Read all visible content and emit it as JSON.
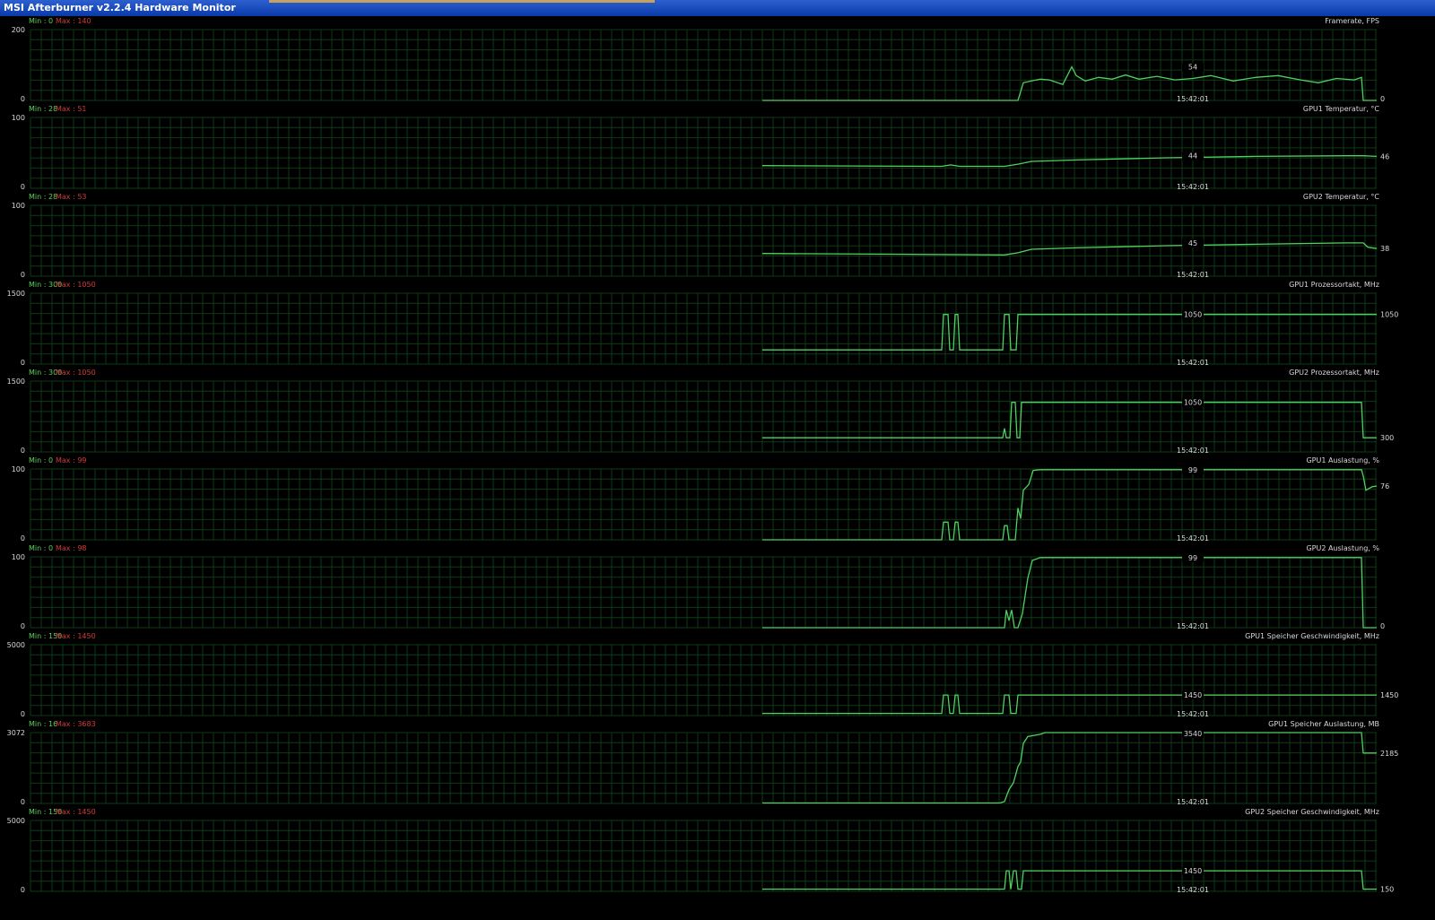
{
  "window": {
    "title": "MSI Afterburner v2.2.4 Hardware Monitor"
  },
  "colors": {
    "grid": "#0e3a16",
    "line": "#50d060",
    "text": "#d8d8d8",
    "min": "#5fcf5f",
    "max": "#cf3a3a"
  },
  "time_label": "15:42:01",
  "graphs": [
    {
      "name": "Framerate, FPS",
      "ymax_label": "200",
      "ymin_label": "0",
      "min_label": "Min : 0",
      "max_label": "Max : 140",
      "ymax": 200,
      "current_label": "54",
      "right_label": "0",
      "series": [
        [
          850,
          0
        ],
        [
          1135,
          0
        ],
        [
          1141,
          50
        ],
        [
          1150,
          55
        ],
        [
          1160,
          60
        ],
        [
          1170,
          58
        ],
        [
          1185,
          45
        ],
        [
          1195,
          95
        ],
        [
          1200,
          70
        ],
        [
          1210,
          55
        ],
        [
          1225,
          65
        ],
        [
          1240,
          60
        ],
        [
          1255,
          72
        ],
        [
          1270,
          60
        ],
        [
          1290,
          68
        ],
        [
          1310,
          58
        ],
        [
          1330,
          62
        ],
        [
          1350,
          70
        ],
        [
          1375,
          55
        ],
        [
          1400,
          65
        ],
        [
          1425,
          70
        ],
        [
          1450,
          58
        ],
        [
          1470,
          50
        ],
        [
          1490,
          62
        ],
        [
          1510,
          58
        ],
        [
          1518,
          65
        ],
        [
          1520,
          0
        ],
        [
          1535,
          0
        ]
      ]
    },
    {
      "name": "GPU1 Temperatur, °C",
      "ymax_label": "100",
      "ymin_label": "0",
      "min_label": "Min : 28",
      "max_label": "Max : 51",
      "ymax": 100,
      "current_label": "44",
      "right_label": "46",
      "series": [
        [
          850,
          32
        ],
        [
          1050,
          31
        ],
        [
          1060,
          33
        ],
        [
          1070,
          31
        ],
        [
          1120,
          31
        ],
        [
          1135,
          34
        ],
        [
          1150,
          38
        ],
        [
          1200,
          40
        ],
        [
          1300,
          43
        ],
        [
          1400,
          45
        ],
        [
          1500,
          46
        ],
        [
          1520,
          46
        ],
        [
          1535,
          45
        ]
      ]
    },
    {
      "name": "GPU2 Temperatur, °C",
      "ymax_label": "100",
      "ymin_label": "0",
      "min_label": "Min : 28",
      "max_label": "Max : 53",
      "ymax": 100,
      "current_label": "45",
      "right_label": "38",
      "series": [
        [
          850,
          32
        ],
        [
          1000,
          31
        ],
        [
          1120,
          30
        ],
        [
          1135,
          33
        ],
        [
          1150,
          38
        ],
        [
          1200,
          40
        ],
        [
          1300,
          43
        ],
        [
          1400,
          45
        ],
        [
          1500,
          47
        ],
        [
          1520,
          47
        ],
        [
          1525,
          41
        ],
        [
          1535,
          39
        ]
      ]
    },
    {
      "name": "GPU1 Prozessortakt, MHz",
      "ymax_label": "1500",
      "ymin_label": "0",
      "min_label": "Min : 300",
      "max_label": "Max : 1050",
      "ymax": 1500,
      "current_label": "1050",
      "right_label": "1050",
      "series": [
        [
          850,
          300
        ],
        [
          1050,
          300
        ],
        [
          1052,
          1050
        ],
        [
          1057,
          1050
        ],
        [
          1059,
          300
        ],
        [
          1063,
          300
        ],
        [
          1065,
          1050
        ],
        [
          1068,
          1050
        ],
        [
          1070,
          300
        ],
        [
          1118,
          300
        ],
        [
          1120,
          1050
        ],
        [
          1125,
          1050
        ],
        [
          1127,
          300
        ],
        [
          1133,
          300
        ],
        [
          1135,
          1050
        ],
        [
          1535,
          1050
        ]
      ]
    },
    {
      "name": "GPU2 Prozessortakt, MHz",
      "ymax_label": "1500",
      "ymin_label": "0",
      "min_label": "Min : 300",
      "max_label": "Max : 1050",
      "ymax": 1500,
      "current_label": "1050",
      "right_label": "300",
      "series": [
        [
          850,
          300
        ],
        [
          1118,
          300
        ],
        [
          1120,
          500
        ],
        [
          1122,
          300
        ],
        [
          1126,
          300
        ],
        [
          1128,
          1050
        ],
        [
          1132,
          1050
        ],
        [
          1134,
          300
        ],
        [
          1137,
          300
        ],
        [
          1139,
          1050
        ],
        [
          1518,
          1050
        ],
        [
          1520,
          300
        ],
        [
          1535,
          300
        ]
      ]
    },
    {
      "name": "GPU1 Auslastung, %",
      "ymax_label": "100",
      "ymin_label": "0",
      "min_label": "Min : 0",
      "max_label": "Max : 99",
      "ymax": 100,
      "current_label": "99",
      "right_label": "76",
      "series": [
        [
          850,
          0
        ],
        [
          1050,
          0
        ],
        [
          1052,
          25
        ],
        [
          1057,
          25
        ],
        [
          1059,
          0
        ],
        [
          1063,
          0
        ],
        [
          1065,
          25
        ],
        [
          1068,
          25
        ],
        [
          1070,
          0
        ],
        [
          1118,
          0
        ],
        [
          1120,
          20
        ],
        [
          1123,
          20
        ],
        [
          1125,
          0
        ],
        [
          1132,
          0
        ],
        [
          1135,
          45
        ],
        [
          1138,
          30
        ],
        [
          1141,
          70
        ],
        [
          1147,
          78
        ],
        [
          1152,
          98
        ],
        [
          1160,
          99
        ],
        [
          1300,
          99
        ],
        [
          1518,
          99
        ],
        [
          1520,
          90
        ],
        [
          1523,
          70
        ],
        [
          1530,
          75
        ],
        [
          1535,
          76
        ]
      ]
    },
    {
      "name": "GPU2 Auslastung, %",
      "ymax_label": "100",
      "ymin_label": "0",
      "min_label": "Min : 0",
      "max_label": "Max : 98",
      "ymax": 100,
      "current_label": "99",
      "right_label": "0",
      "series": [
        [
          850,
          0
        ],
        [
          1120,
          0
        ],
        [
          1122,
          25
        ],
        [
          1125,
          10
        ],
        [
          1128,
          25
        ],
        [
          1131,
          0
        ],
        [
          1135,
          0
        ],
        [
          1140,
          20
        ],
        [
          1146,
          70
        ],
        [
          1151,
          95
        ],
        [
          1160,
          99
        ],
        [
          1518,
          99
        ],
        [
          1520,
          0
        ],
        [
          1535,
          0
        ]
      ]
    },
    {
      "name": "GPU1 Speicher Geschwindigkeit, MHz",
      "ymax_label": "5000",
      "ymin_label": "0",
      "min_label": "Min : 150",
      "max_label": "Max : 1450",
      "ymax": 5000,
      "current_label": "1450",
      "right_label": "1450",
      "series": [
        [
          850,
          150
        ],
        [
          1050,
          150
        ],
        [
          1052,
          1450
        ],
        [
          1057,
          1450
        ],
        [
          1059,
          150
        ],
        [
          1063,
          150
        ],
        [
          1065,
          1450
        ],
        [
          1068,
          1450
        ],
        [
          1070,
          150
        ],
        [
          1118,
          150
        ],
        [
          1120,
          1450
        ],
        [
          1125,
          1450
        ],
        [
          1127,
          150
        ],
        [
          1133,
          150
        ],
        [
          1135,
          1450
        ],
        [
          1535,
          1450
        ]
      ]
    },
    {
      "name": "GPU1 Speicher Auslastung, MB",
      "ymax_label": "3072",
      "ymin_label": "0",
      "min_label": "Min : 16",
      "max_label": "Max : 3683",
      "ymax": 3072,
      "current_label": "3540",
      "right_label": "2185",
      "series": [
        [
          850,
          20
        ],
        [
          1115,
          20
        ],
        [
          1120,
          80
        ],
        [
          1125,
          600
        ],
        [
          1130,
          900
        ],
        [
          1135,
          1600
        ],
        [
          1138,
          1800
        ],
        [
          1141,
          2600
        ],
        [
          1146,
          2900
        ],
        [
          1160,
          3000
        ],
        [
          1165,
          3072
        ],
        [
          1518,
          3072
        ],
        [
          1520,
          2185
        ],
        [
          1535,
          2185
        ]
      ]
    },
    {
      "name": "GPU2 Speicher Geschwindigkeit, MHz",
      "ymax_label": "5000",
      "ymin_label": "0",
      "min_label": "Min : 150",
      "max_label": "Max : 1450",
      "ymax": 5000,
      "current_label": "1450",
      "right_label": "150",
      "series": [
        [
          850,
          150
        ],
        [
          1120,
          150
        ],
        [
          1122,
          1450
        ],
        [
          1125,
          1450
        ],
        [
          1127,
          150
        ],
        [
          1130,
          1450
        ],
        [
          1133,
          1450
        ],
        [
          1135,
          150
        ],
        [
          1139,
          150
        ],
        [
          1141,
          1450
        ],
        [
          1518,
          1450
        ],
        [
          1520,
          150
        ],
        [
          1535,
          150
        ]
      ]
    }
  ]
}
